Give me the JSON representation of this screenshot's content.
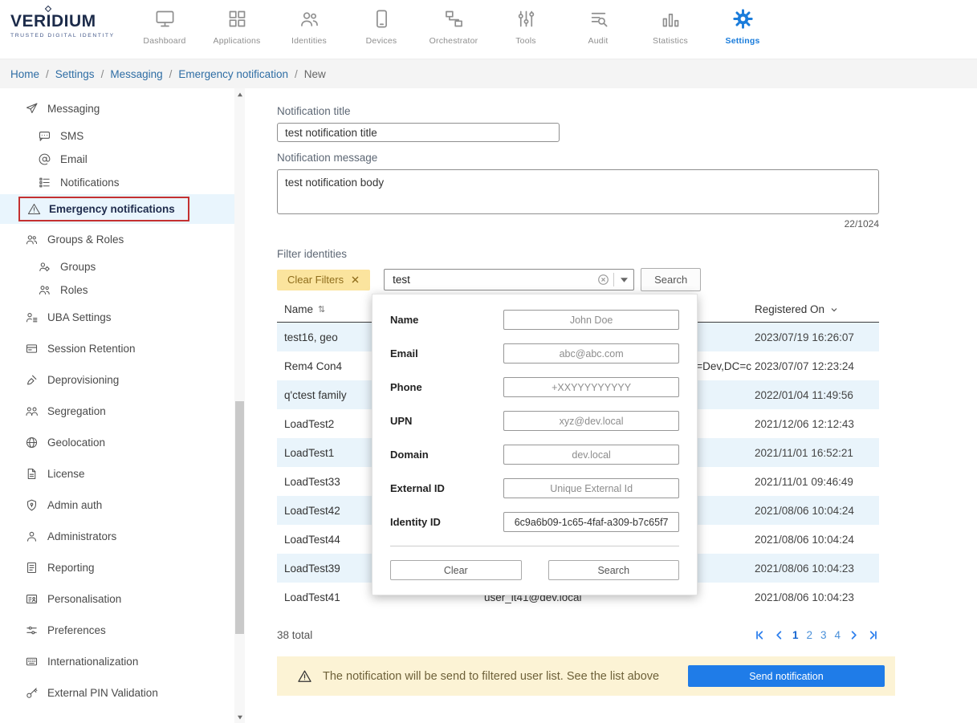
{
  "brand": {
    "name": "VERIDIUM",
    "tagline": "TRUSTED DIGITAL IDENTITY"
  },
  "topnav": {
    "items": [
      {
        "label": "Dashboard",
        "icon": "dashboard-icon",
        "active": false
      },
      {
        "label": "Applications",
        "icon": "applications-icon",
        "active": false
      },
      {
        "label": "Identities",
        "icon": "identities-icon",
        "active": false
      },
      {
        "label": "Devices",
        "icon": "devices-icon",
        "active": false
      },
      {
        "label": "Orchestrator",
        "icon": "orchestrator-icon",
        "active": false
      },
      {
        "label": "Tools",
        "icon": "tools-icon",
        "active": false
      },
      {
        "label": "Audit",
        "icon": "audit-icon",
        "active": false
      },
      {
        "label": "Statistics",
        "icon": "statistics-icon",
        "active": false
      },
      {
        "label": "Settings",
        "icon": "settings-icon",
        "active": true
      }
    ]
  },
  "breadcrumb": {
    "separator": "/",
    "items": [
      {
        "label": "Home",
        "link": true
      },
      {
        "label": "Settings",
        "link": true
      },
      {
        "label": "Messaging",
        "link": true
      },
      {
        "label": "Emergency notification",
        "link": true
      },
      {
        "label": "New",
        "link": false
      }
    ]
  },
  "sidebar": {
    "items": [
      {
        "label": "Messaging",
        "icon": "send-icon",
        "level": 0,
        "selected": false
      },
      {
        "label": "SMS",
        "icon": "sms-icon",
        "level": 1,
        "selected": false
      },
      {
        "label": "Email",
        "icon": "at-icon",
        "level": 1,
        "selected": false
      },
      {
        "label": "Notifications",
        "icon": "list-icon",
        "level": 1,
        "selected": false
      },
      {
        "label": "Emergency notifications",
        "icon": "warning-icon",
        "level": 1,
        "selected": true
      },
      {
        "label": "Groups & Roles",
        "icon": "people-icon",
        "level": 0,
        "selected": false
      },
      {
        "label": "Groups",
        "icon": "group-gear-icon",
        "level": 1,
        "selected": false
      },
      {
        "label": "Roles",
        "icon": "roles-icon",
        "level": 1,
        "selected": false
      },
      {
        "label": "UBA Settings",
        "icon": "uba-icon",
        "level": 0,
        "selected": false
      },
      {
        "label": "Session Retention",
        "icon": "session-icon",
        "level": 0,
        "selected": false
      },
      {
        "label": "Deprovisioning",
        "icon": "deprovision-icon",
        "level": 0,
        "selected": false
      },
      {
        "label": "Segregation",
        "icon": "segregation-icon",
        "level": 0,
        "selected": false
      },
      {
        "label": "Geolocation",
        "icon": "globe-icon",
        "level": 0,
        "selected": false
      },
      {
        "label": "License",
        "icon": "license-icon",
        "level": 0,
        "selected": false
      },
      {
        "label": "Admin auth",
        "icon": "shield-lock-icon",
        "level": 0,
        "selected": false
      },
      {
        "label": "Administrators",
        "icon": "person-icon",
        "level": 0,
        "selected": false
      },
      {
        "label": "Reporting",
        "icon": "report-icon",
        "level": 0,
        "selected": false
      },
      {
        "label": "Personalisation",
        "icon": "personalisation-icon",
        "level": 0,
        "selected": false
      },
      {
        "label": "Preferences",
        "icon": "preferences-icon",
        "level": 0,
        "selected": false
      },
      {
        "label": "Internationalization",
        "icon": "i18n-icon",
        "level": 0,
        "selected": false
      },
      {
        "label": "External PIN Validation",
        "icon": "key-icon",
        "level": 0,
        "selected": false
      }
    ]
  },
  "form": {
    "title_label": "Notification title",
    "title_value": "test notification title",
    "message_label": "Notification message",
    "message_value": "test notification body",
    "char_count": "22/1024"
  },
  "filter": {
    "label": "Filter identities",
    "clear_filters_label": "Clear Filters",
    "search_value": "test",
    "search_button_label": "Search"
  },
  "popup": {
    "fields": [
      {
        "label": "Name",
        "placeholder": "John Doe",
        "value": ""
      },
      {
        "label": "Email",
        "placeholder": "abc@abc.com",
        "value": ""
      },
      {
        "label": "Phone",
        "placeholder": "+XXYYYYYYYYY",
        "value": ""
      },
      {
        "label": "UPN",
        "placeholder": "xyz@dev.local",
        "value": ""
      },
      {
        "label": "Domain",
        "placeholder": "dev.local",
        "value": ""
      },
      {
        "label": "External ID",
        "placeholder": "Unique External Id",
        "value": ""
      },
      {
        "label": "Identity ID",
        "placeholder": "",
        "value": "6c9a6b09-1c65-4faf-a309-b7c65f7"
      }
    ],
    "clear_label": "Clear",
    "search_label": "Search"
  },
  "table": {
    "name_header": "Name",
    "registered_header": "Registered On",
    "rows": [
      {
        "name": "test16, geo",
        "middle": "",
        "middle_align": "left",
        "registered": "2023/07/19 16:26:07"
      },
      {
        "name": "Rem4 Con4",
        "middle": ",OU=Dev,DC=c",
        "middle_align": "right",
        "registered": "2023/07/07 12:23:24"
      },
      {
        "name": "q'ctest family",
        "middle": "",
        "middle_align": "left",
        "registered": "2022/01/04 11:49:56"
      },
      {
        "name": "LoadTest2",
        "middle": "",
        "middle_align": "left",
        "registered": "2021/12/06 12:12:43"
      },
      {
        "name": "LoadTest1",
        "middle": "",
        "middle_align": "left",
        "registered": "2021/11/01 16:52:21"
      },
      {
        "name": "LoadTest33",
        "middle": "",
        "middle_align": "left",
        "registered": "2021/11/01 09:46:49"
      },
      {
        "name": "LoadTest42",
        "middle": "",
        "middle_align": "left",
        "registered": "2021/08/06 10:04:24"
      },
      {
        "name": "LoadTest44",
        "middle": "",
        "middle_align": "left",
        "registered": "2021/08/06 10:04:24"
      },
      {
        "name": "LoadTest39",
        "middle": "",
        "middle_align": "left",
        "registered": "2021/08/06 10:04:23"
      },
      {
        "name": "LoadTest41",
        "middle": "user_lt41@dev.local",
        "middle_align": "left",
        "registered": "2021/08/06 10:04:23"
      }
    ],
    "total": "38 total"
  },
  "pagination": {
    "pages": [
      "1",
      "2",
      "3",
      "4"
    ],
    "active": "1"
  },
  "alert": {
    "message": "The notification will be send to filtered user list. See the list above",
    "button_label": "Send notification"
  },
  "colors": {
    "accent": "#1a7cdb",
    "selected_item_border": "#c43131",
    "selected_item_bg": "#e9f5fd",
    "chip_bg": "#fbe49e",
    "alert_bg": "#fcf3d5",
    "row_stripe": "#e9f4fb",
    "send_button_bg": "#1f7ce8"
  }
}
